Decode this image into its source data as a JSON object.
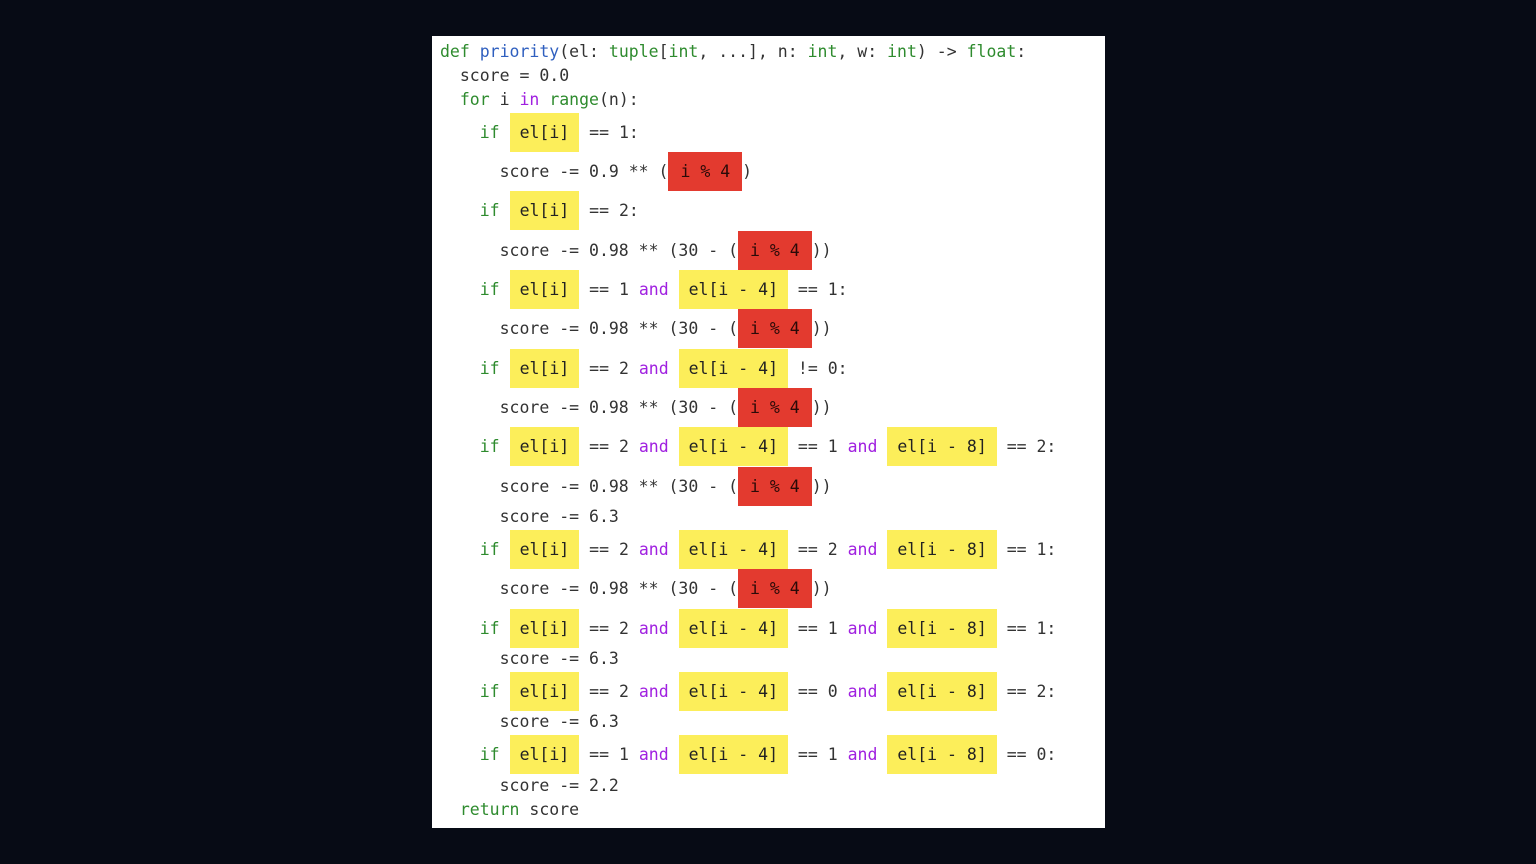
{
  "colors": {
    "background": "#070b15",
    "panel": "#ffffff",
    "keyword": "#2e8b2e",
    "function": "#2f5fbf",
    "operator": "#a020e0",
    "highlight_yellow": "#fcee5a",
    "highlight_red": "#e33a2f"
  },
  "code": {
    "lines": [
      [
        {
          "t": "def",
          "c": "kw"
        },
        {
          "t": " "
        },
        {
          "t": "priority",
          "c": "fn"
        },
        {
          "t": "(el: "
        },
        {
          "t": "tuple",
          "c": "kw"
        },
        {
          "t": "["
        },
        {
          "t": "int",
          "c": "kw"
        },
        {
          "t": ", ...], n: "
        },
        {
          "t": "int",
          "c": "kw"
        },
        {
          "t": ", w: "
        },
        {
          "t": "int",
          "c": "kw"
        },
        {
          "t": ") -> "
        },
        {
          "t": "float",
          "c": "kw"
        },
        {
          "t": ":"
        }
      ],
      [
        {
          "t": "  score = 0.0"
        }
      ],
      [
        {
          "t": "  "
        },
        {
          "t": "for",
          "c": "kw"
        },
        {
          "t": " i "
        },
        {
          "t": "in",
          "c": "op"
        },
        {
          "t": " "
        },
        {
          "t": "range",
          "c": "kw"
        },
        {
          "t": "(n):"
        }
      ],
      [
        {
          "t": "    "
        },
        {
          "t": "if",
          "c": "kw"
        },
        {
          "t": " "
        },
        {
          "t": "el[i]",
          "h": "y"
        },
        {
          "t": " == 1:"
        }
      ],
      [
        {
          "t": "      score -= 0.9 ** ("
        },
        {
          "t": "i % 4",
          "h": "r"
        },
        {
          "t": ")"
        }
      ],
      [
        {
          "t": "    "
        },
        {
          "t": "if",
          "c": "kw"
        },
        {
          "t": " "
        },
        {
          "t": "el[i]",
          "h": "y"
        },
        {
          "t": " == 2:"
        }
      ],
      [
        {
          "t": "      score -= 0.98 ** (30 - ("
        },
        {
          "t": "i % 4",
          "h": "r"
        },
        {
          "t": "))"
        }
      ],
      [
        {
          "t": "    "
        },
        {
          "t": "if",
          "c": "kw"
        },
        {
          "t": " "
        },
        {
          "t": "el[i]",
          "h": "y"
        },
        {
          "t": " == 1 "
        },
        {
          "t": "and",
          "c": "op"
        },
        {
          "t": " "
        },
        {
          "t": "el[i - 4]",
          "h": "y"
        },
        {
          "t": " == 1:"
        }
      ],
      [
        {
          "t": "      score -= 0.98 ** (30 - ("
        },
        {
          "t": "i % 4",
          "h": "r"
        },
        {
          "t": "))"
        }
      ],
      [
        {
          "t": "    "
        },
        {
          "t": "if",
          "c": "kw"
        },
        {
          "t": " "
        },
        {
          "t": "el[i]",
          "h": "y"
        },
        {
          "t": " == 2 "
        },
        {
          "t": "and",
          "c": "op"
        },
        {
          "t": " "
        },
        {
          "t": "el[i - 4]",
          "h": "y"
        },
        {
          "t": " != 0:"
        }
      ],
      [
        {
          "t": "      score -= 0.98 ** (30 - ("
        },
        {
          "t": "i % 4",
          "h": "r"
        },
        {
          "t": "))"
        }
      ],
      [
        {
          "t": "    "
        },
        {
          "t": "if",
          "c": "kw"
        },
        {
          "t": " "
        },
        {
          "t": "el[i]",
          "h": "y"
        },
        {
          "t": " == 2 "
        },
        {
          "t": "and",
          "c": "op"
        },
        {
          "t": " "
        },
        {
          "t": "el[i - 4]",
          "h": "y"
        },
        {
          "t": " == 1 "
        },
        {
          "t": "and",
          "c": "op"
        },
        {
          "t": " "
        },
        {
          "t": "el[i - 8]",
          "h": "y"
        },
        {
          "t": " == 2:"
        }
      ],
      [
        {
          "t": "      score -= 0.98 ** (30 - ("
        },
        {
          "t": "i % 4",
          "h": "r"
        },
        {
          "t": "))"
        }
      ],
      [
        {
          "t": "      score -= 6.3"
        }
      ],
      [
        {
          "t": "    "
        },
        {
          "t": "if",
          "c": "kw"
        },
        {
          "t": " "
        },
        {
          "t": "el[i]",
          "h": "y"
        },
        {
          "t": " == 2 "
        },
        {
          "t": "and",
          "c": "op"
        },
        {
          "t": " "
        },
        {
          "t": "el[i - 4]",
          "h": "y"
        },
        {
          "t": " == 2 "
        },
        {
          "t": "and",
          "c": "op"
        },
        {
          "t": " "
        },
        {
          "t": "el[i - 8]",
          "h": "y"
        },
        {
          "t": " == 1:"
        }
      ],
      [
        {
          "t": "      score -= 0.98 ** (30 - ("
        },
        {
          "t": "i % 4",
          "h": "r"
        },
        {
          "t": "))"
        }
      ],
      [
        {
          "t": "    "
        },
        {
          "t": "if",
          "c": "kw"
        },
        {
          "t": " "
        },
        {
          "t": "el[i]",
          "h": "y"
        },
        {
          "t": " == 2 "
        },
        {
          "t": "and",
          "c": "op"
        },
        {
          "t": " "
        },
        {
          "t": "el[i - 4]",
          "h": "y"
        },
        {
          "t": " == 1 "
        },
        {
          "t": "and",
          "c": "op"
        },
        {
          "t": " "
        },
        {
          "t": "el[i - 8]",
          "h": "y"
        },
        {
          "t": " == 1:"
        }
      ],
      [
        {
          "t": "      score -= 6.3"
        }
      ],
      [
        {
          "t": "    "
        },
        {
          "t": "if",
          "c": "kw"
        },
        {
          "t": " "
        },
        {
          "t": "el[i]",
          "h": "y"
        },
        {
          "t": " == 2 "
        },
        {
          "t": "and",
          "c": "op"
        },
        {
          "t": " "
        },
        {
          "t": "el[i - 4]",
          "h": "y"
        },
        {
          "t": " == 0 "
        },
        {
          "t": "and",
          "c": "op"
        },
        {
          "t": " "
        },
        {
          "t": "el[i - 8]",
          "h": "y"
        },
        {
          "t": " == 2:"
        }
      ],
      [
        {
          "t": "      score -= 6.3"
        }
      ],
      [
        {
          "t": "    "
        },
        {
          "t": "if",
          "c": "kw"
        },
        {
          "t": " "
        },
        {
          "t": "el[i]",
          "h": "y"
        },
        {
          "t": " == 1 "
        },
        {
          "t": "and",
          "c": "op"
        },
        {
          "t": " "
        },
        {
          "t": "el[i - 4]",
          "h": "y"
        },
        {
          "t": " == 1 "
        },
        {
          "t": "and",
          "c": "op"
        },
        {
          "t": " "
        },
        {
          "t": "el[i - 8]",
          "h": "y"
        },
        {
          "t": " == 0:"
        }
      ],
      [
        {
          "t": "      score -= 2.2"
        }
      ],
      [
        {
          "t": "  "
        },
        {
          "t": "return",
          "c": "kw"
        },
        {
          "t": " score"
        }
      ]
    ]
  }
}
